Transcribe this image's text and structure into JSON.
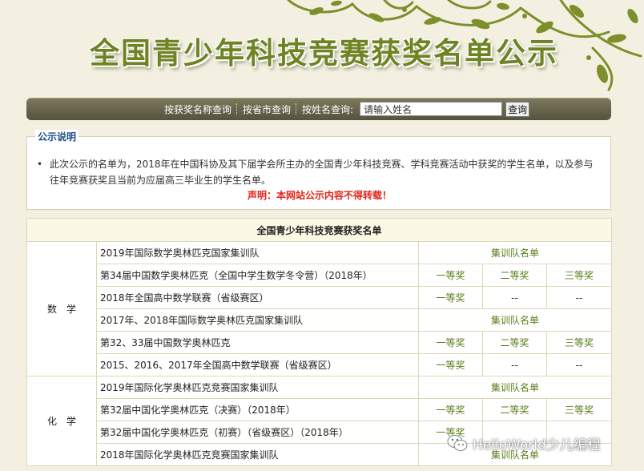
{
  "banner": {
    "title": "全国青少年科技竞赛获奖名单公示"
  },
  "search": {
    "link_by_award": "按获奖名称查询",
    "link_by_city": "按省市查询",
    "name_label": "按姓名查询:",
    "name_input_value": "请输入姓名",
    "submit_label": "查询"
  },
  "notice": {
    "legend": "公示说明",
    "text": "此次公示的名单为，2018年在中国科协及其下届学会所主办的全国青少年科技竞赛、学科竞赛活动中获奖的学生名单，以及参与往年竞赛获奖且当前为应届高三毕业生的学生名单。",
    "warning": "声明：本网站公示内容不得转载！"
  },
  "table": {
    "header": "全国青少年科技竞赛获奖名单",
    "groups": [
      {
        "subject": "数学",
        "rows": [
          {
            "competition": "2019年国际数学奥林匹克国家集训队",
            "span": "集训队名单"
          },
          {
            "competition": "第34届中国数学奥林匹克（全国中学生数学冬令营）（2018年）",
            "c1": "一等奖",
            "c2": "二等奖",
            "c3": "三等奖"
          },
          {
            "competition": "2018年全国高中数学联赛（省级赛区）",
            "c1": "一等奖",
            "c2": "--",
            "c3": "--"
          },
          {
            "competition": "2017年、2018年国际数学奥林匹克国家集训队",
            "span": "集训队名单"
          },
          {
            "competition": "第32、33届中国数学奥林匹克",
            "c1": "一等奖",
            "c2": "二等奖",
            "c3": "三等奖"
          },
          {
            "competition": "2015、2016、2017年全国高中数学联赛（省级赛区）",
            "c1": "一等奖",
            "c2": "--",
            "c3": "--"
          }
        ]
      },
      {
        "subject": "化学",
        "rows": [
          {
            "competition": "2019年国际化学奥林匹克竞赛国家集训队",
            "span": "集训队名单"
          },
          {
            "competition": "第32届中国化学奥林匹克（决赛）（2018年）",
            "c1": "一等奖",
            "c2": "二等奖",
            "c3": "三等奖"
          },
          {
            "competition": "第32届中国化学奥林匹克（初赛）（省级赛区）（2018年）",
            "c1": "一等奖",
            "c2": "",
            "c3": ""
          },
          {
            "competition": "2018年国际化学奥林匹克竞赛国家集训队",
            "span": "集训队名单"
          }
        ]
      }
    ]
  },
  "watermark": {
    "text": "HelloWorld少儿编程",
    "icon": "wechat-icon"
  },
  "colors": {
    "title_green": "#6e8424",
    "bar_dark": "#55523e",
    "award_green": "#5a7d18",
    "warning_red": "#e0231a",
    "legend_blue": "#1c4f86"
  }
}
